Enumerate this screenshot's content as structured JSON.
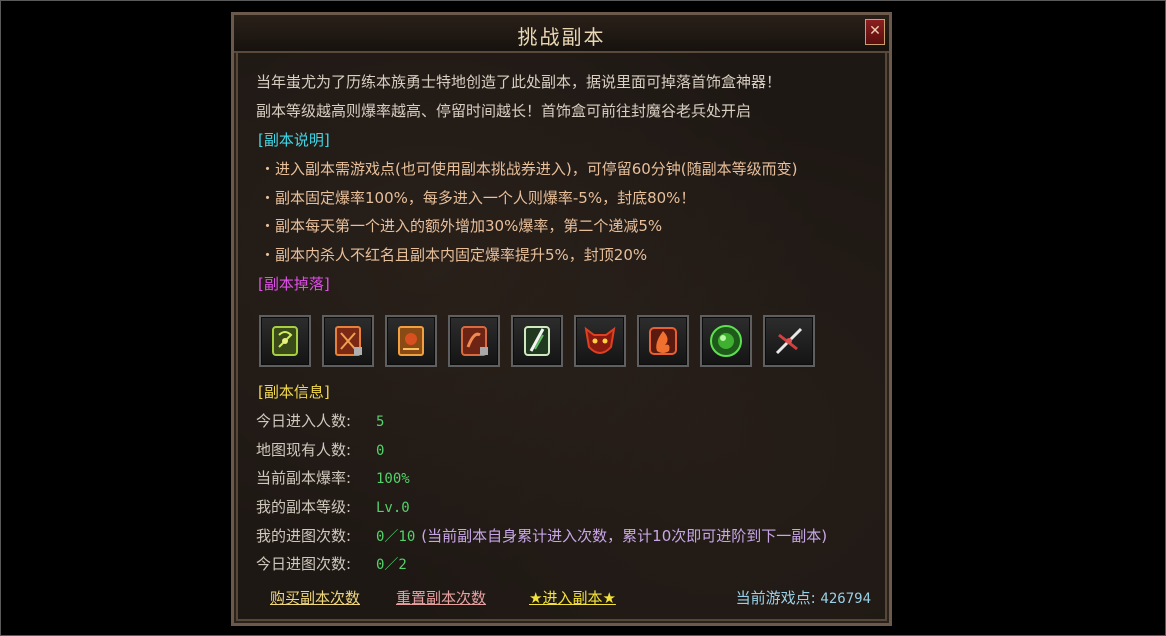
{
  "dialog": {
    "title": "挑战副本",
    "close_glyph": "✕"
  },
  "intro": {
    "line1": "当年蚩尤为了历练本族勇士特地创造了此处副本，据说里面可掉落首饰盒神器！",
    "line2": "副本等级越高则爆率越高、停留时间越长！首饰盒可前往封魔谷老兵处开启"
  },
  "description": {
    "header": "[副本说明]",
    "bullets": [
      "・进入副本需游戏点(也可使用副本挑战券进入)，可停留60分钟(随副本等级而变)",
      "・副本固定爆率100%，每多进入一个人则爆率-5%，封底80%！",
      "・副本每天第一个进入的额外增加30%爆率，第二个递减5%",
      "・副本内杀人不红名且副本内固定爆率提升5%，封顶20%"
    ]
  },
  "drops": {
    "header": "[副本掉落]",
    "items": [
      {
        "icon": "green-scroll-icon",
        "color": "#7fbf2a"
      },
      {
        "icon": "red-book-icon",
        "color": "#d8502a"
      },
      {
        "icon": "orange-book-icon",
        "color": "#e0842a"
      },
      {
        "icon": "red-scroll-icon",
        "color": "#c8502e"
      },
      {
        "icon": "white-green-scroll-icon",
        "color": "#bfe0b0"
      },
      {
        "icon": "demon-mask-icon",
        "color": "#c23020"
      },
      {
        "icon": "flame-emblem-icon",
        "color": "#e0502a"
      },
      {
        "icon": "green-orb-icon",
        "color": "#3fc23a"
      },
      {
        "icon": "crossed-blades-icon",
        "color": "#d04040"
      }
    ]
  },
  "info": {
    "header": "[副本信息]",
    "rows": [
      {
        "label": "今日进入人数:",
        "value": "5"
      },
      {
        "label": "地图现有人数:",
        "value": "0"
      },
      {
        "label": "当前副本爆率:",
        "value": "100%"
      },
      {
        "label": "我的副本等级:",
        "value": "Lv.0"
      },
      {
        "label": "我的进图次数:",
        "value": "0／10",
        "note": "(当前副本自身累计进入次数，累计10次即可进阶到下一副本)"
      },
      {
        "label": "今日进图次数:",
        "value": "0／2"
      }
    ]
  },
  "footer": {
    "buy_label": "购买副本次数",
    "reset_label": "重置副本次数",
    "enter_label": "★进入副本★",
    "points_label": "当前游戏点:",
    "points_value": "426794"
  }
}
